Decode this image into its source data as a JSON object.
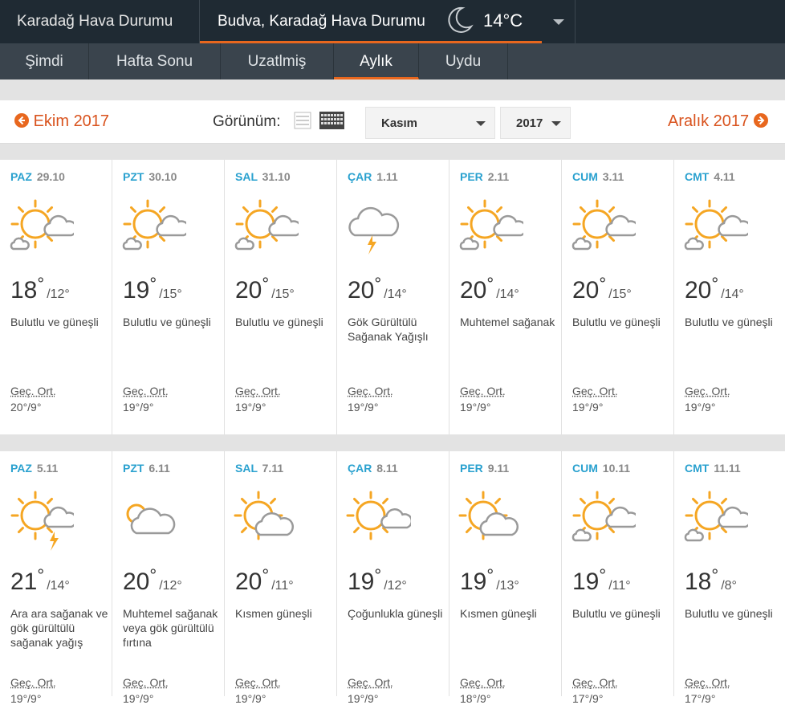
{
  "header": {
    "country": "Karadağ Hava Durumu",
    "location": "Budva, Karadağ Hava Durumu",
    "temp": "14°C"
  },
  "tabs": [
    {
      "label": "Şimdi"
    },
    {
      "label": "Hafta Sonu"
    },
    {
      "label": "Uzatlmiş"
    },
    {
      "label": "Aylık"
    },
    {
      "label": "Uydu"
    }
  ],
  "nav": {
    "prev": "Ekim 2017",
    "next": "Aralık 2017",
    "view_label": "Görünüm:",
    "month": "Kasım",
    "year": "2017"
  },
  "colors": {
    "accent": "#e8671e",
    "day_name": "#2aa1cf",
    "sun": "#f5a623",
    "cloud": "#9a9a9a"
  },
  "weeks": [
    [
      {
        "day": "PAZ",
        "date": "29.10",
        "icon": "sun-cloud-icon",
        "hi": "18",
        "lo": "/12°",
        "desc": "Bulutlu ve güneşli",
        "avg_label": "Geç. Ort.",
        "avg": "20°/9°"
      },
      {
        "day": "PZT",
        "date": "30.10",
        "icon": "sun-cloud-icon",
        "hi": "19",
        "lo": "/15°",
        "desc": "Bulutlu ve güneşli",
        "avg_label": "Geç. Ort.",
        "avg": "19°/9°"
      },
      {
        "day": "SAL",
        "date": "31.10",
        "icon": "sun-cloud-icon",
        "hi": "20",
        "lo": "/15°",
        "desc": "Bulutlu ve güneşli",
        "avg_label": "Geç. Ort.",
        "avg": "19°/9°"
      },
      {
        "day": "ÇAR",
        "date": "1.11",
        "icon": "thunder-cloud-icon",
        "hi": "20",
        "lo": "/14°",
        "desc": "Gök Gürültülü Sağanak Yağışlı",
        "avg_label": "Geç. Ort.",
        "avg": "19°/9°"
      },
      {
        "day": "PER",
        "date": "2.11",
        "icon": "sun-cloud-icon",
        "hi": "20",
        "lo": "/14°",
        "desc": "Muhtemel sağanak",
        "avg_label": "Geç. Ort.",
        "avg": "19°/9°"
      },
      {
        "day": "CUM",
        "date": "3.11",
        "icon": "sun-cloud-icon",
        "hi": "20",
        "lo": "/15°",
        "desc": "Bulutlu ve güneşli",
        "avg_label": "Geç. Ort.",
        "avg": "19°/9°"
      },
      {
        "day": "CMT",
        "date": "4.11",
        "icon": "sun-cloud-icon",
        "hi": "20",
        "lo": "/14°",
        "desc": "Bulutlu ve güneşli",
        "avg_label": "Geç. Ort.",
        "avg": "19°/9°"
      }
    ],
    [
      {
        "day": "PAZ",
        "date": "5.11",
        "icon": "sun-thunder-icon",
        "hi": "21",
        "lo": "/14°",
        "desc": "Ara ara sağanak ve gök gürültülü sağanak yağış",
        "avg_label": "Geç. Ort.",
        "avg": "19°/9°"
      },
      {
        "day": "PZT",
        "date": "6.11",
        "icon": "cloudy-sun-icon",
        "hi": "20",
        "lo": "/12°",
        "desc": "Muhtemel sağanak veya gök gürültülü fırtına",
        "avg_label": "Geç. Ort.",
        "avg": "19°/9°"
      },
      {
        "day": "SAL",
        "date": "7.11",
        "icon": "partly-sunny-icon",
        "hi": "20",
        "lo": "/11°",
        "desc": "Kısmen güneşli",
        "avg_label": "Geç. Ort.",
        "avg": "19°/9°"
      },
      {
        "day": "ÇAR",
        "date": "8.11",
        "icon": "mostly-sunny-icon",
        "hi": "19",
        "lo": "/12°",
        "desc": "Çoğunlukla güneşli",
        "avg_label": "Geç. Ort.",
        "avg": "19°/9°"
      },
      {
        "day": "PER",
        "date": "9.11",
        "icon": "partly-sunny-icon",
        "hi": "19",
        "lo": "/13°",
        "desc": "Kısmen güneşli",
        "avg_label": "Geç. Ort.",
        "avg": "18°/9°"
      },
      {
        "day": "CUM",
        "date": "10.11",
        "icon": "sun-cloud-icon",
        "hi": "19",
        "lo": "/11°",
        "desc": "Bulutlu ve güneşli",
        "avg_label": "Geç. Ort.",
        "avg": "17°/9°"
      },
      {
        "day": "CMT",
        "date": "11.11",
        "icon": "sun-cloud-icon",
        "hi": "18",
        "lo": "/8°",
        "desc": "Bulutlu ve güneşli",
        "avg_label": "Geç. Ort.",
        "avg": "17°/9°"
      }
    ]
  ]
}
